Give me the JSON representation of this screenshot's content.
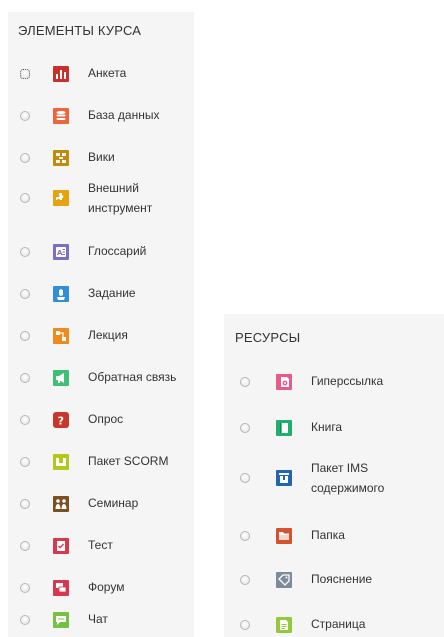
{
  "activities": {
    "title": "ЭЛЕМЕНТЫ КУРСА",
    "items": [
      {
        "label": "Анкета"
      },
      {
        "label": "База данных"
      },
      {
        "label": "Вики"
      },
      {
        "label_line1": "Внешний",
        "label_line2": "инструмент"
      },
      {
        "label": "Глоссарий"
      },
      {
        "label": "Задание"
      },
      {
        "label": "Лекция"
      },
      {
        "label": "Обратная связь"
      },
      {
        "label": "Опрос"
      },
      {
        "label": "Пакет SCORM"
      },
      {
        "label": "Семинар"
      },
      {
        "label": "Тест"
      },
      {
        "label": "Форум"
      },
      {
        "label": "Чат"
      }
    ]
  },
  "resources": {
    "title": "РЕСУРСЫ",
    "items": [
      {
        "label": "Гиперссылка"
      },
      {
        "label": "Книга"
      },
      {
        "label_line1": "Пакет IMS",
        "label_line2": "содержимого"
      },
      {
        "label": "Папка"
      },
      {
        "label": "Пояснение"
      },
      {
        "label": "Страница"
      }
    ]
  },
  "icons": {
    "feedback-survey-icon": "#c9302c",
    "database-icon": "#f0643c",
    "wiki-icon": "#c58a07",
    "external-tool-icon": "#e7a30f",
    "glossary-icon": "#7a6fc0",
    "assignment-icon": "#2f8fd8",
    "lesson-icon": "#ef8a1e",
    "feedback-icon": "#3fbf74",
    "choice-icon": "#c8372d",
    "scorm-icon": "#b3c818",
    "workshop-icon": "#7b4f1f",
    "quiz-icon": "#d9364f",
    "forum-icon": "#d9364f",
    "chat-icon": "#76c043",
    "url-icon": "#e85a88",
    "book-icon": "#1fb06f",
    "ims-package-icon": "#2167b0",
    "folder-icon": "#d4522f",
    "label-icon": "#7d8c9a",
    "page-icon": "#94c83d"
  }
}
